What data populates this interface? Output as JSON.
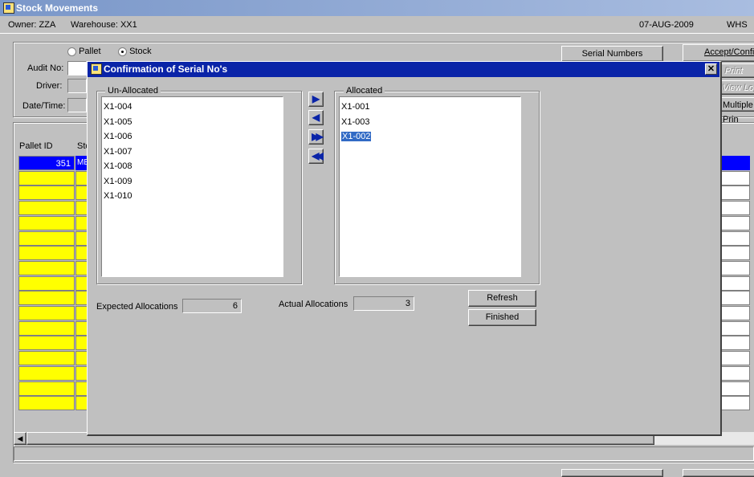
{
  "window": {
    "title": "Stock Movements"
  },
  "info": {
    "owner": "Owner: ZZA",
    "warehouse": "Warehouse: XX1",
    "date": "07-AUG-2009",
    "whs": "WHS"
  },
  "form": {
    "radio_pallet": "Pallet",
    "radio_stock": "Stock",
    "audit_label": "Audit No:",
    "driver_label": "Driver:",
    "datetime_label": "Date/Time:",
    "serial_button": "Serial Numbers",
    "accept_button": "Accept/Confi",
    "print_button": "Print",
    "view_log_button": "View Log",
    "multiple_print_button": "Multiple Prin"
  },
  "grid": {
    "col_pallet": "Pallet ID",
    "col_stock": "Sto",
    "first_row_id": "351",
    "first_row_stock": "MB"
  },
  "dialog": {
    "title": "Confirmation of Serial No's",
    "close": "✕",
    "unallocated_label": "Un-Allocated",
    "allocated_label": "Allocated",
    "unallocated": [
      "X1-004",
      "X1-005",
      "X1-006",
      "X1-007",
      "X1-008",
      "X1-009",
      "X1-010"
    ],
    "allocated": [
      "X1-001",
      "X1-003",
      "X1-002"
    ],
    "expected_label": "Expected Allocations",
    "expected_value": "6",
    "actual_label": "Actual Allocations",
    "actual_value": "3",
    "refresh_button": "Refresh",
    "finished_button": "Finished"
  }
}
